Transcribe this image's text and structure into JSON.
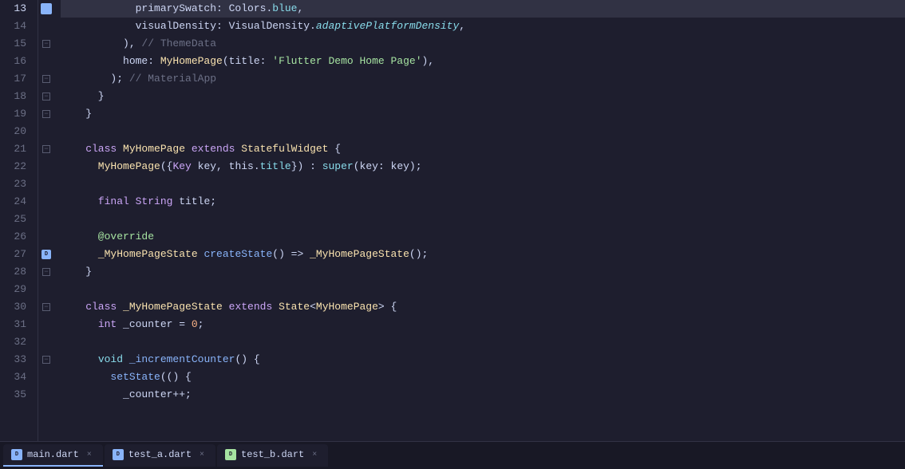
{
  "tabs": [
    {
      "id": "main",
      "label": "main.dart",
      "active": true,
      "icon": "dart-main"
    },
    {
      "id": "test_a",
      "label": "test_a.dart",
      "active": false,
      "icon": "dart-a"
    },
    {
      "id": "test_b",
      "label": "test_b.dart",
      "active": false,
      "icon": "dart-b"
    }
  ],
  "lines": [
    {
      "num": 13,
      "indent": 6,
      "has_fold": false,
      "is_debug": false,
      "is_active": false,
      "tokens": [
        {
          "type": "plain",
          "text": "            primarySwatch: Colors."
        },
        {
          "type": "prop",
          "text": "blue"
        },
        {
          "type": "plain",
          "text": ","
        }
      ]
    },
    {
      "num": 14,
      "tokens": [
        {
          "type": "plain",
          "text": "            visualDensity: VisualDensity."
        },
        {
          "type": "italic",
          "text": "adaptivePlatformDensity"
        },
        {
          "type": "plain",
          "text": ","
        }
      ]
    },
    {
      "num": 15,
      "has_fold": true,
      "tokens": [
        {
          "type": "plain",
          "text": "          ), "
        },
        {
          "type": "comment",
          "text": "// ThemeData"
        }
      ]
    },
    {
      "num": 16,
      "tokens": [
        {
          "type": "plain",
          "text": "          home: "
        },
        {
          "type": "cls",
          "text": "MyHomePage"
        },
        {
          "type": "plain",
          "text": "(title: "
        },
        {
          "type": "string",
          "text": "'Flutter Demo Home Page'"
        },
        {
          "type": "plain",
          "text": "),"
        }
      ]
    },
    {
      "num": 17,
      "has_fold": true,
      "tokens": [
        {
          "type": "plain",
          "text": "        ); "
        },
        {
          "type": "comment",
          "text": "// MaterialApp"
        }
      ]
    },
    {
      "num": 18,
      "has_fold": true,
      "tokens": [
        {
          "type": "plain",
          "text": "      }"
        }
      ]
    },
    {
      "num": 19,
      "has_fold": true,
      "tokens": [
        {
          "type": "plain",
          "text": "    }"
        }
      ]
    },
    {
      "num": 20,
      "tokens": []
    },
    {
      "num": 21,
      "has_fold": true,
      "tokens": [
        {
          "type": "kw",
          "text": "    class "
        },
        {
          "type": "cls",
          "text": "MyHomePage "
        },
        {
          "type": "kw",
          "text": "extends "
        },
        {
          "type": "cls",
          "text": "StatefulWidget "
        },
        {
          "type": "plain",
          "text": "{"
        }
      ]
    },
    {
      "num": 22,
      "tokens": [
        {
          "type": "cls",
          "text": "      MyHomePage"
        },
        {
          "type": "plain",
          "text": "({"
        },
        {
          "type": "dart-type",
          "text": "Key"
        },
        {
          "type": "plain",
          "text": " key, this."
        },
        {
          "type": "prop",
          "text": "title"
        },
        {
          "type": "plain",
          "text": "}) : "
        },
        {
          "type": "kw2",
          "text": "super"
        },
        {
          "type": "plain",
          "text": "(key: key);"
        }
      ]
    },
    {
      "num": 23,
      "tokens": []
    },
    {
      "num": 24,
      "has_fold": false,
      "tokens": [
        {
          "type": "plain",
          "text": "      "
        },
        {
          "type": "kw",
          "text": "final "
        },
        {
          "type": "dart-type",
          "text": "String "
        },
        {
          "type": "plain",
          "text": "title;"
        }
      ]
    },
    {
      "num": 25,
      "tokens": []
    },
    {
      "num": 26,
      "tokens": [
        {
          "type": "annot",
          "text": "      @override"
        }
      ]
    },
    {
      "num": 27,
      "is_debug": true,
      "tokens": [
        {
          "type": "plain",
          "text": "      "
        },
        {
          "type": "cls",
          "text": "_MyHomePageState "
        },
        {
          "type": "fn-name",
          "text": "createState"
        },
        {
          "type": "plain",
          "text": "() => "
        },
        {
          "type": "cls",
          "text": "_MyHomePageState"
        },
        {
          "type": "plain",
          "text": "();"
        }
      ]
    },
    {
      "num": 28,
      "has_fold": true,
      "tokens": [
        {
          "type": "plain",
          "text": "    }"
        }
      ]
    },
    {
      "num": 29,
      "tokens": []
    },
    {
      "num": 30,
      "has_fold": true,
      "tokens": [
        {
          "type": "kw",
          "text": "    class "
        },
        {
          "type": "cls",
          "text": "_MyHomePageState "
        },
        {
          "type": "kw",
          "text": "extends "
        },
        {
          "type": "cls",
          "text": "State"
        },
        {
          "type": "plain",
          "text": "<"
        },
        {
          "type": "cls",
          "text": "MyHomePage"
        },
        {
          "type": "plain",
          "text": "> {"
        }
      ]
    },
    {
      "num": 31,
      "tokens": [
        {
          "type": "plain",
          "text": "      "
        },
        {
          "type": "kw",
          "text": "int "
        },
        {
          "type": "plain",
          "text": "_counter = "
        },
        {
          "type": "num",
          "text": "0"
        },
        {
          "type": "plain",
          "text": ";"
        }
      ]
    },
    {
      "num": 32,
      "tokens": []
    },
    {
      "num": 33,
      "has_fold": true,
      "tokens": [
        {
          "type": "plain",
          "text": "      "
        },
        {
          "type": "kw2",
          "text": "void "
        },
        {
          "type": "fn-name",
          "text": "_incrementCounter"
        },
        {
          "type": "plain",
          "text": "() {"
        }
      ]
    },
    {
      "num": 34,
      "tokens": [
        {
          "type": "plain",
          "text": "        "
        },
        {
          "type": "fn-name",
          "text": "setState"
        },
        {
          "type": "plain",
          "text": "(() {"
        }
      ]
    },
    {
      "num": 35,
      "tokens": [
        {
          "type": "plain",
          "text": "          _counter++;"
        }
      ]
    }
  ],
  "active_line": 13,
  "gutter_items": {
    "13": "blue-square",
    "15": "fold",
    "17": "fold",
    "18": "fold",
    "19": "fold",
    "21": "fold",
    "27": "debug",
    "28": "fold",
    "30": "fold",
    "33": "fold"
  }
}
